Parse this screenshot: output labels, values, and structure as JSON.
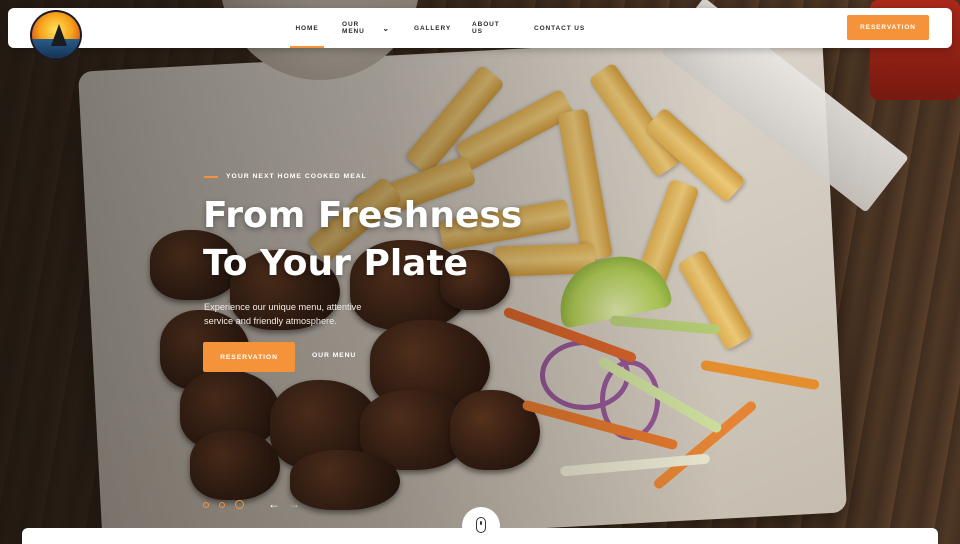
{
  "nav": {
    "items": [
      {
        "label": "HOME",
        "active": true
      },
      {
        "label": "OUR MENU",
        "has_dropdown": true
      },
      {
        "label": "GALLERY"
      },
      {
        "label": "ABOUT US"
      },
      {
        "label": "CONTACT US"
      }
    ],
    "reservation_label": "RESERVATION"
  },
  "hero": {
    "eyebrow": "YOUR NEXT HOME COOKED MEAL",
    "headline_line1": "From Freshness",
    "headline_line2": "To Your Plate",
    "subtext": "Experience our unique menu, attentive service and friendly atmosphere.",
    "primary_button": "RESERVATION",
    "secondary_link": "OUR MENU"
  },
  "slider": {
    "slide_count": 3,
    "active_slide": 3,
    "prev_icon": "arrow-left-icon",
    "next_icon": "arrow-right-icon"
  },
  "icons": {
    "scroll": "mouse-icon",
    "dropdown": "chevron-down-icon"
  },
  "colors": {
    "accent": "#f4933a",
    "nav_bg": "#ffffff",
    "text_dark": "#2b2b2b"
  }
}
